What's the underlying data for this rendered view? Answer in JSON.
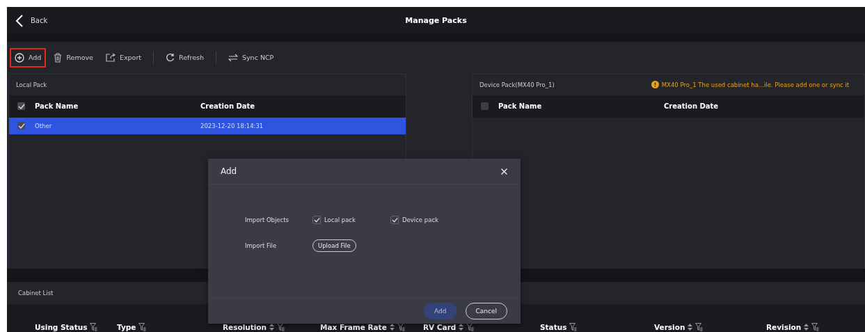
{
  "header": {
    "back": "Back",
    "title": "Manage Packs"
  },
  "toolbar_groups": [
    [
      {
        "kind": "add",
        "label": "Add",
        "highlighted": true
      },
      {
        "kind": "remove",
        "label": "Remove",
        "highlighted": false
      },
      {
        "kind": "export",
        "label": "Export",
        "highlighted": false
      }
    ],
    [
      {
        "kind": "refresh",
        "label": "Refresh",
        "highlighted": false
      }
    ],
    [
      {
        "kind": "sync",
        "label": "Sync NCP",
        "highlighted": false
      }
    ]
  ],
  "local_pack": {
    "title": "Local Pack",
    "all_checked": true,
    "columns": [
      "Pack Name",
      "Creation Date"
    ],
    "rows": [
      {
        "name": "Other",
        "date": "2023-12-20 18:14:31",
        "checked": true,
        "selected": true
      }
    ]
  },
  "device_pack": {
    "title": "Device Pack(MX40 Pro_1)",
    "warning": "MX40 Pro_1 The used cabinet ha...ile. Please add one or sync it",
    "all_checked": false,
    "columns": [
      "Pack Name",
      "Creation Date"
    ]
  },
  "cabinet_list": {
    "title": "Cabinet List",
    "columns": [
      {
        "label": "Using Status",
        "sortable": false,
        "filterable": true
      },
      {
        "label": "Type",
        "sortable": false,
        "filterable": true
      },
      {
        "label": "Resolution",
        "sortable": true,
        "filterable": true
      },
      {
        "label": "Max Frame Rate",
        "sortable": true,
        "filterable": true
      },
      {
        "label": "RV Card",
        "sortable": true,
        "filterable": true
      },
      {
        "label": "Status",
        "sortable": false,
        "filterable": true
      },
      {
        "label": "Version",
        "sortable": true,
        "filterable": true
      },
      {
        "label": "Revision",
        "sortable": true,
        "filterable": true
      }
    ]
  },
  "dialog": {
    "title": "Add",
    "import_objects_label": "Import Objects",
    "options": [
      {
        "label": "Local pack",
        "checked": true
      },
      {
        "label": "Device pack",
        "checked": true
      }
    ],
    "import_file_label": "Import File",
    "upload_label": "Upload File",
    "buttons": [
      {
        "kind": "primary",
        "label": "Add",
        "disabled": true
      },
      {
        "kind": "secondary",
        "label": "Cancel",
        "disabled": false
      }
    ]
  }
}
